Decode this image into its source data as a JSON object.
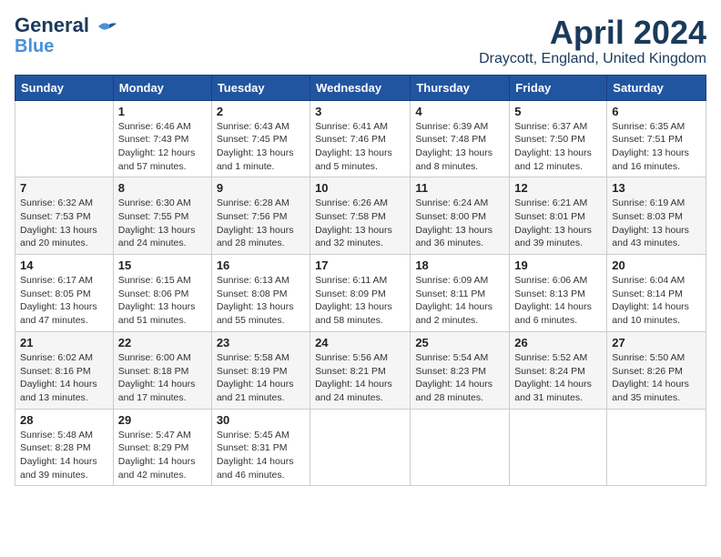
{
  "header": {
    "logo_line1": "General",
    "logo_line2": "Blue",
    "month_title": "April 2024",
    "location": "Draycott, England, United Kingdom"
  },
  "weekdays": [
    "Sunday",
    "Monday",
    "Tuesday",
    "Wednesday",
    "Thursday",
    "Friday",
    "Saturday"
  ],
  "weeks": [
    [
      {
        "day": "",
        "info": ""
      },
      {
        "day": "1",
        "info": "Sunrise: 6:46 AM\nSunset: 7:43 PM\nDaylight: 12 hours\nand 57 minutes."
      },
      {
        "day": "2",
        "info": "Sunrise: 6:43 AM\nSunset: 7:45 PM\nDaylight: 13 hours\nand 1 minute."
      },
      {
        "day": "3",
        "info": "Sunrise: 6:41 AM\nSunset: 7:46 PM\nDaylight: 13 hours\nand 5 minutes."
      },
      {
        "day": "4",
        "info": "Sunrise: 6:39 AM\nSunset: 7:48 PM\nDaylight: 13 hours\nand 8 minutes."
      },
      {
        "day": "5",
        "info": "Sunrise: 6:37 AM\nSunset: 7:50 PM\nDaylight: 13 hours\nand 12 minutes."
      },
      {
        "day": "6",
        "info": "Sunrise: 6:35 AM\nSunset: 7:51 PM\nDaylight: 13 hours\nand 16 minutes."
      }
    ],
    [
      {
        "day": "7",
        "info": "Sunrise: 6:32 AM\nSunset: 7:53 PM\nDaylight: 13 hours\nand 20 minutes."
      },
      {
        "day": "8",
        "info": "Sunrise: 6:30 AM\nSunset: 7:55 PM\nDaylight: 13 hours\nand 24 minutes."
      },
      {
        "day": "9",
        "info": "Sunrise: 6:28 AM\nSunset: 7:56 PM\nDaylight: 13 hours\nand 28 minutes."
      },
      {
        "day": "10",
        "info": "Sunrise: 6:26 AM\nSunset: 7:58 PM\nDaylight: 13 hours\nand 32 minutes."
      },
      {
        "day": "11",
        "info": "Sunrise: 6:24 AM\nSunset: 8:00 PM\nDaylight: 13 hours\nand 36 minutes."
      },
      {
        "day": "12",
        "info": "Sunrise: 6:21 AM\nSunset: 8:01 PM\nDaylight: 13 hours\nand 39 minutes."
      },
      {
        "day": "13",
        "info": "Sunrise: 6:19 AM\nSunset: 8:03 PM\nDaylight: 13 hours\nand 43 minutes."
      }
    ],
    [
      {
        "day": "14",
        "info": "Sunrise: 6:17 AM\nSunset: 8:05 PM\nDaylight: 13 hours\nand 47 minutes."
      },
      {
        "day": "15",
        "info": "Sunrise: 6:15 AM\nSunset: 8:06 PM\nDaylight: 13 hours\nand 51 minutes."
      },
      {
        "day": "16",
        "info": "Sunrise: 6:13 AM\nSunset: 8:08 PM\nDaylight: 13 hours\nand 55 minutes."
      },
      {
        "day": "17",
        "info": "Sunrise: 6:11 AM\nSunset: 8:09 PM\nDaylight: 13 hours\nand 58 minutes."
      },
      {
        "day": "18",
        "info": "Sunrise: 6:09 AM\nSunset: 8:11 PM\nDaylight: 14 hours\nand 2 minutes."
      },
      {
        "day": "19",
        "info": "Sunrise: 6:06 AM\nSunset: 8:13 PM\nDaylight: 14 hours\nand 6 minutes."
      },
      {
        "day": "20",
        "info": "Sunrise: 6:04 AM\nSunset: 8:14 PM\nDaylight: 14 hours\nand 10 minutes."
      }
    ],
    [
      {
        "day": "21",
        "info": "Sunrise: 6:02 AM\nSunset: 8:16 PM\nDaylight: 14 hours\nand 13 minutes."
      },
      {
        "day": "22",
        "info": "Sunrise: 6:00 AM\nSunset: 8:18 PM\nDaylight: 14 hours\nand 17 minutes."
      },
      {
        "day": "23",
        "info": "Sunrise: 5:58 AM\nSunset: 8:19 PM\nDaylight: 14 hours\nand 21 minutes."
      },
      {
        "day": "24",
        "info": "Sunrise: 5:56 AM\nSunset: 8:21 PM\nDaylight: 14 hours\nand 24 minutes."
      },
      {
        "day": "25",
        "info": "Sunrise: 5:54 AM\nSunset: 8:23 PM\nDaylight: 14 hours\nand 28 minutes."
      },
      {
        "day": "26",
        "info": "Sunrise: 5:52 AM\nSunset: 8:24 PM\nDaylight: 14 hours\nand 31 minutes."
      },
      {
        "day": "27",
        "info": "Sunrise: 5:50 AM\nSunset: 8:26 PM\nDaylight: 14 hours\nand 35 minutes."
      }
    ],
    [
      {
        "day": "28",
        "info": "Sunrise: 5:48 AM\nSunset: 8:28 PM\nDaylight: 14 hours\nand 39 minutes."
      },
      {
        "day": "29",
        "info": "Sunrise: 5:47 AM\nSunset: 8:29 PM\nDaylight: 14 hours\nand 42 minutes."
      },
      {
        "day": "30",
        "info": "Sunrise: 5:45 AM\nSunset: 8:31 PM\nDaylight: 14 hours\nand 46 minutes."
      },
      {
        "day": "",
        "info": ""
      },
      {
        "day": "",
        "info": ""
      },
      {
        "day": "",
        "info": ""
      },
      {
        "day": "",
        "info": ""
      }
    ]
  ]
}
